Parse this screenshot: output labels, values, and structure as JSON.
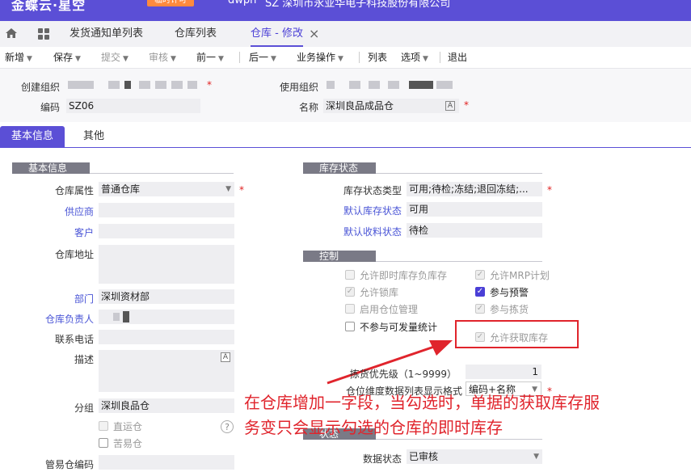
{
  "topbar": {
    "brand": "金蝶云·星空",
    "badge": "临时许可",
    "mid": "dwpn",
    "org": "SZ 深圳市永亚华电子科技股份有限公司"
  },
  "tabs": [
    {
      "label": "发货通知单列表"
    },
    {
      "label": "仓库列表"
    },
    {
      "label": "仓库 - 修改"
    }
  ],
  "toolbar": {
    "new": "新增",
    "save": "保存",
    "submit": "提交",
    "audit": "审核",
    "prev": "前一",
    "next": "后一",
    "business": "业务操作",
    "list": "列表",
    "options": "选项",
    "exit": "退出"
  },
  "header": {
    "create_org_label": "创建组织",
    "use_org_label": "使用组织",
    "code_label": "编码",
    "code_value": "SZ06",
    "name_label": "名称",
    "name_value": "深圳良品成品仓"
  },
  "section_tabs": {
    "basic": "基本信息",
    "other": "其他"
  },
  "basic": {
    "title": "基本信息",
    "property_label": "仓库属性",
    "property_value": "普通仓库",
    "supplier_label": "供应商",
    "customer_label": "客户",
    "address_label": "仓库地址",
    "dept_label": "部门",
    "dept_value": "深圳资材部",
    "manager_label": "仓库负责人",
    "phone_label": "联系电话",
    "desc_label": "描述",
    "group_label": "分组",
    "group_value": "深圳良品仓",
    "transit_label": "直运仓",
    "custody_label": "苦易仓",
    "custody_code_label": "管易仓编码"
  },
  "stock": {
    "title": "库存状态",
    "type_label": "库存状态类型",
    "type_value": "可用;待检;冻结;退回冻结;...",
    "default_label": "默认库存状态",
    "default_value": "可用",
    "receive_label": "默认收料状态",
    "receive_value": "待检"
  },
  "control": {
    "title": "控制",
    "neg_label": "允许即时库存负库存",
    "mrp_label": "允许MRP计划",
    "lock_label": "允许锁库",
    "warn_label": "参与预警",
    "loc_label": "启用仓位管理",
    "pick_label": "参与拣货",
    "nostat_label": "不参与可发量统计",
    "fetch_label": "允许获取库存",
    "priority_label": "拣货优先级（1~9999）",
    "priority_value": "1",
    "format_label": "仓位维度数据列表显示格式",
    "format_value": "编码+名称"
  },
  "status": {
    "title": "状态",
    "data_label": "数据状态",
    "data_value": "已审核"
  },
  "annotation": {
    "line1": "在仓库增加一字段，当勾选时，单据的获取库存服",
    "line2": "务变只会显示勾选的仓库的即时库存",
    "color": "#e0242c"
  },
  "colors": {
    "brand": "#5b4fd6",
    "required": "#e02020",
    "link": "#4a55d6"
  }
}
